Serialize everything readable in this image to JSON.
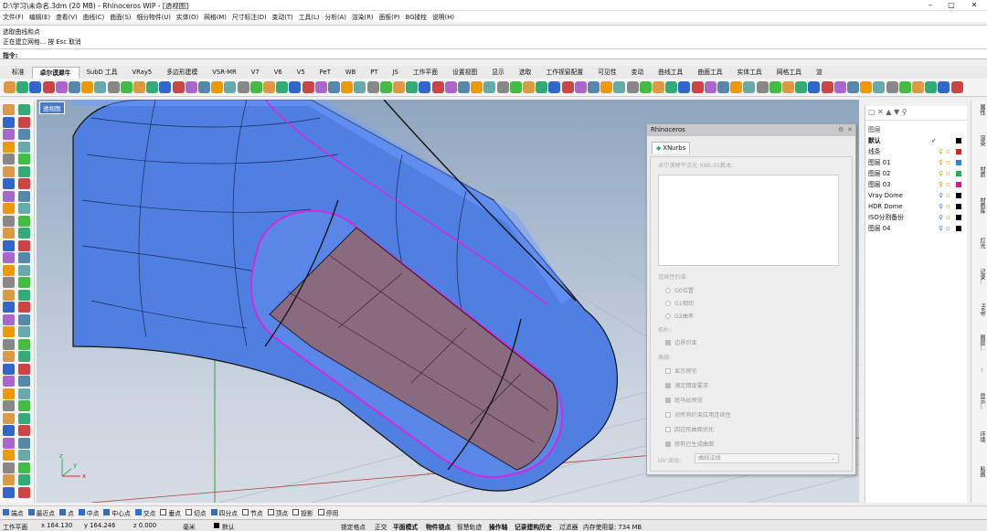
{
  "window": {
    "title": "D:\\学习\\未命名.3dm (20 MB) - Rhinoceros WIP - [透视图]",
    "minimize": "–",
    "maximize": "□",
    "close": "✕"
  },
  "menu": [
    "文件(F)",
    "编辑(E)",
    "查看(V)",
    "曲线(C)",
    "曲面(S)",
    "细分物件(U)",
    "实体(O)",
    "网格(M)",
    "尺寸标注(D)",
    "变动(T)",
    "工具(L)",
    "分析(A)",
    "渲染(R)",
    "面板(P)",
    "BG揉栓",
    "说明(H)"
  ],
  "command_history": [
    "选取曲线和点",
    "正在建立网格... 按 Esc 取消"
  ],
  "command_prompt": "指令:",
  "tabs": [
    "标准",
    "卓尔谟犀牛",
    "SubD 工具",
    "VRay5",
    "多边形建模",
    "VSR-MR",
    "V7",
    "V6",
    "V5",
    "PeT",
    "WB",
    "PT",
    "JS",
    "工作平面",
    "设置视图",
    "显示",
    "选取",
    "工作视窗配置",
    "可见性",
    "变动",
    "曲线工具",
    "曲面工具",
    "实体工具",
    "网格工具",
    "渲"
  ],
  "active_tab_index": 1,
  "viewport": {
    "label": "透视图",
    "axis_x": "x",
    "axis_y": "y",
    "axis_z": "z"
  },
  "xnurbs": {
    "window_title": "Rhinoceros",
    "tab": "XNurbs",
    "doc_label": "卓尔谟犀牛汉化·XNS.01教本:",
    "continuity_header": "连续性约束:",
    "options": [
      "G0位置",
      "G1相切",
      "G2曲率"
    ],
    "extend_header": "拓扑:",
    "boundary_label": "边界约束",
    "advanced_header": "高级:",
    "checkboxes": [
      {
        "label": "显示预览",
        "checked": false
      },
      {
        "label": "满足精度要求",
        "checked": true
      },
      {
        "label": "斑马纹预览",
        "checked": true
      },
      {
        "label": "对所有约束应用连续性",
        "checked": false
      },
      {
        "label": "四边形曲面优化",
        "checked": false
      },
      {
        "label": "修剪已生成曲面",
        "checked": true
      }
    ],
    "uv_label": "UV 流动:",
    "uv_value": "曲线法线"
  },
  "layers": {
    "header": "图层",
    "rows": [
      {
        "name": "默认",
        "current": "✓",
        "color": "#000000",
        "bold": true
      },
      {
        "name": "线条",
        "color": "#e02020"
      },
      {
        "name": "图层 01",
        "color": "#2a8ae0"
      },
      {
        "name": "图层 02",
        "color": "#22b14c"
      },
      {
        "name": "图层 03",
        "color": "#d81b8a"
      },
      {
        "name": "Vray Dome",
        "color": "#000000"
      },
      {
        "name": "HDR Dome",
        "color": "#000000"
      },
      {
        "name": "ISO分割备份",
        "color": "#000000"
      },
      {
        "name": "图层 04",
        "color": "#000000"
      }
    ]
  },
  "right_tabs": [
    "属性",
    "渲染",
    "材质",
    "材质库",
    "灯光",
    "记录...",
    "Help",
    "图层...",
    "...",
    "显示...",
    "环境",
    "贴图"
  ],
  "osnaps": [
    {
      "label": "端点",
      "on": true
    },
    {
      "label": "最近点",
      "on": true
    },
    {
      "label": "点",
      "on": true
    },
    {
      "label": "中点",
      "on": true
    },
    {
      "label": "中心点",
      "on": true
    },
    {
      "label": "交点",
      "on": true
    },
    {
      "label": "垂点",
      "on": false
    },
    {
      "label": "切点",
      "on": false
    },
    {
      "label": "四分点",
      "on": true
    },
    {
      "label": "节点",
      "on": false
    },
    {
      "label": "顶点",
      "on": false
    },
    {
      "label": "投影",
      "on": false
    },
    {
      "label": "停用",
      "on": false
    }
  ],
  "status": {
    "plane": "工作平面",
    "x": "x 164.130",
    "y": "y 164.246",
    "z": "z 0.000",
    "unit": "毫米",
    "layer": "默认",
    "grid_snap": "锁定格点",
    "ortho": "正交",
    "planar": "平面模式",
    "osnap": "物件锁点",
    "smart_track": "智慧轨迹",
    "gumball": "操作轴",
    "history": "记录建构历史",
    "filter": "过滤器",
    "memory": "内存使用量: 734 MB"
  }
}
